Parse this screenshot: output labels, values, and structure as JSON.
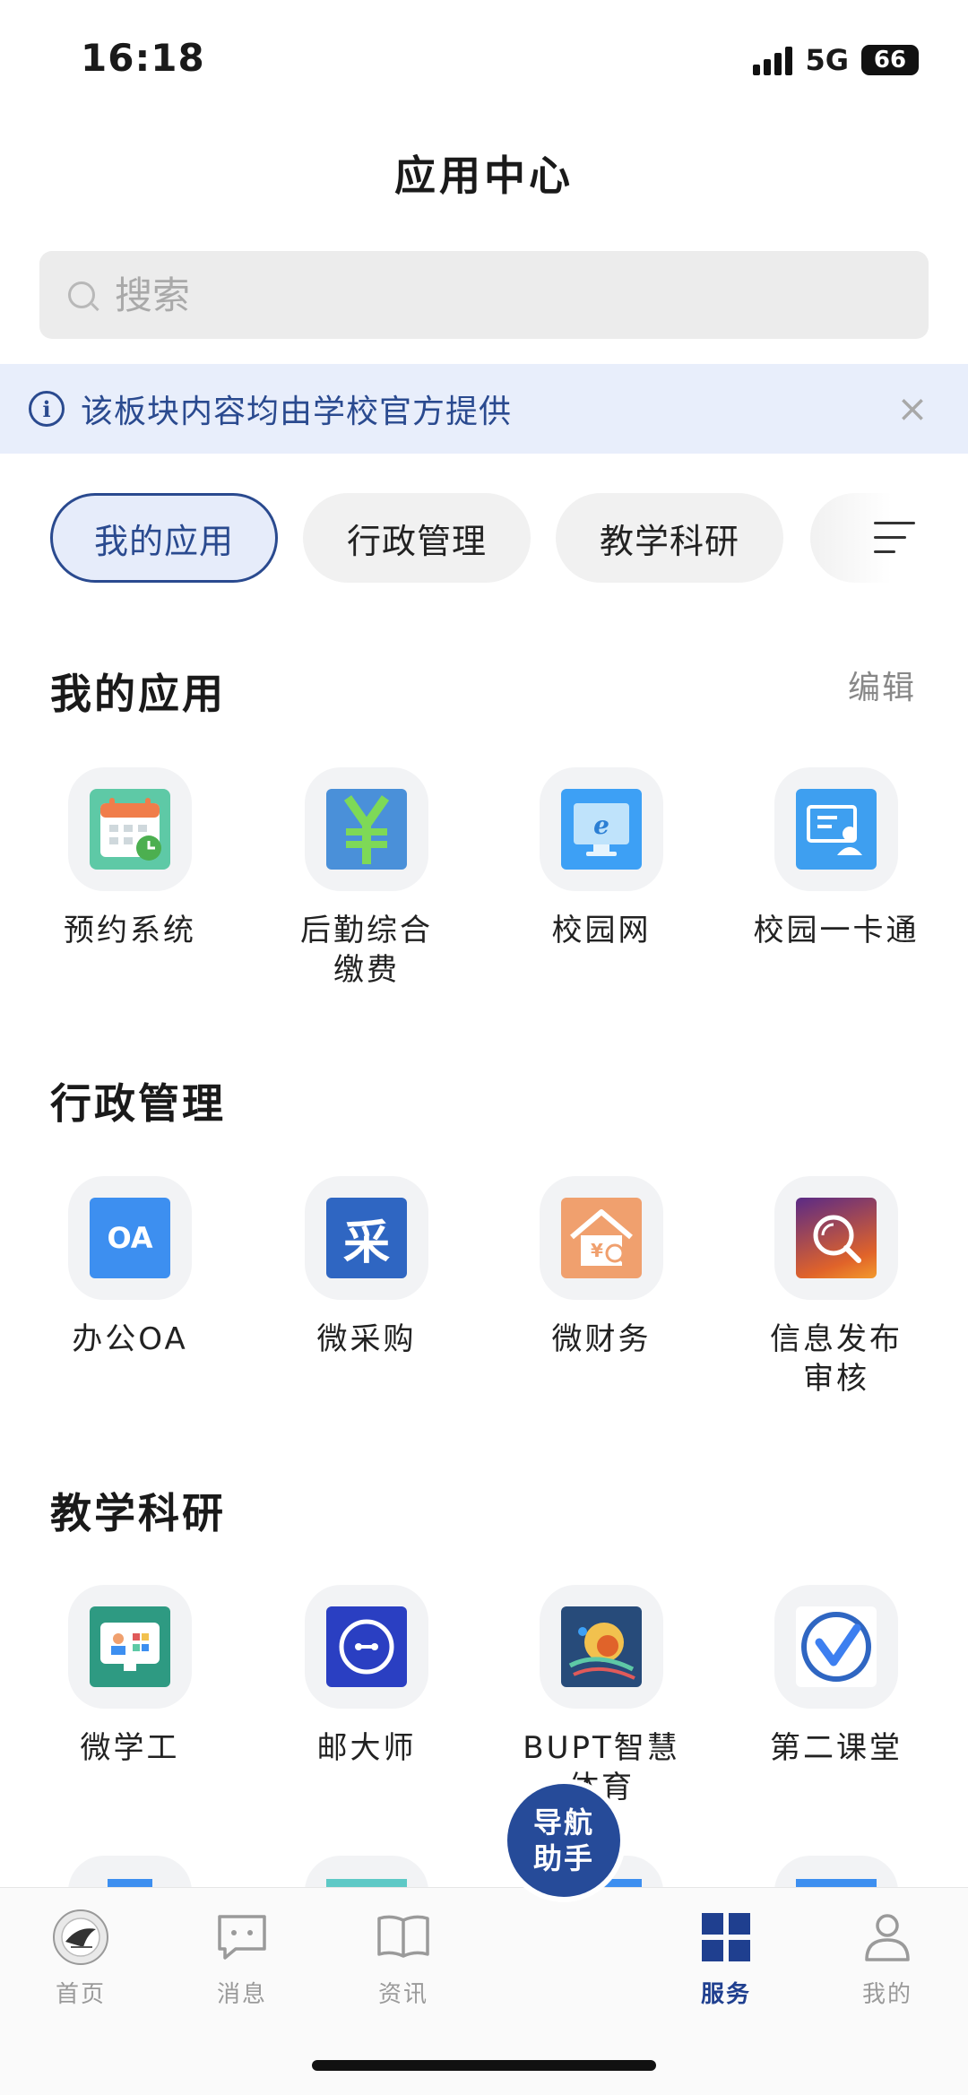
{
  "status": {
    "time": "16:18",
    "network": "5G",
    "battery": "66"
  },
  "header": {
    "title": "应用中心"
  },
  "search": {
    "placeholder": "搜索"
  },
  "notice": {
    "text": "该板块内容均由学校官方提供"
  },
  "tabs": [
    {
      "label": "我的应用",
      "active": true
    },
    {
      "label": "行政管理",
      "active": false
    },
    {
      "label": "教学科研",
      "active": false
    }
  ],
  "sections": {
    "my_apps": {
      "title": "我的应用",
      "edit_label": "编辑",
      "apps": [
        {
          "label": "预约系统",
          "icon": "calendar-icon"
        },
        {
          "label": "后勤综合缴费",
          "icon": "yuan-icon"
        },
        {
          "label": "校园网",
          "icon": "browser-icon"
        },
        {
          "label": "校园一卡通",
          "icon": "card-icon"
        }
      ]
    },
    "admin": {
      "title": "行政管理",
      "apps": [
        {
          "label": "办公OA",
          "icon": "oa-icon",
          "icon_text": "OA"
        },
        {
          "label": "微采购",
          "icon": "purchase-icon",
          "icon_text": "采"
        },
        {
          "label": "微财务",
          "icon": "finance-icon"
        },
        {
          "label": "信息发布审核",
          "icon": "review-icon"
        }
      ]
    },
    "teaching": {
      "title": "教学科研",
      "apps": [
        {
          "label": "微学工",
          "icon": "monitor-icon"
        },
        {
          "label": "邮大师",
          "icon": "mail-master-icon"
        },
        {
          "label": "BUPT智慧体育",
          "icon": "sports-icon"
        },
        {
          "label": "第二课堂",
          "icon": "checkmark-icon"
        }
      ]
    }
  },
  "bottom_nav": {
    "items": [
      {
        "label": "首页",
        "icon": "school-logo-icon"
      },
      {
        "label": "消息",
        "icon": "message-icon"
      },
      {
        "label": "资讯",
        "icon": "book-icon"
      },
      {
        "label": "服务",
        "icon": "grid-icon",
        "active": true
      },
      {
        "label": "我的",
        "icon": "person-icon"
      }
    ],
    "center": {
      "line1": "导航",
      "line2": "助手"
    }
  },
  "colors": {
    "accent": "#2a4a8f",
    "notice_bg": "#e8eefb",
    "nav_center": "#264b99"
  }
}
